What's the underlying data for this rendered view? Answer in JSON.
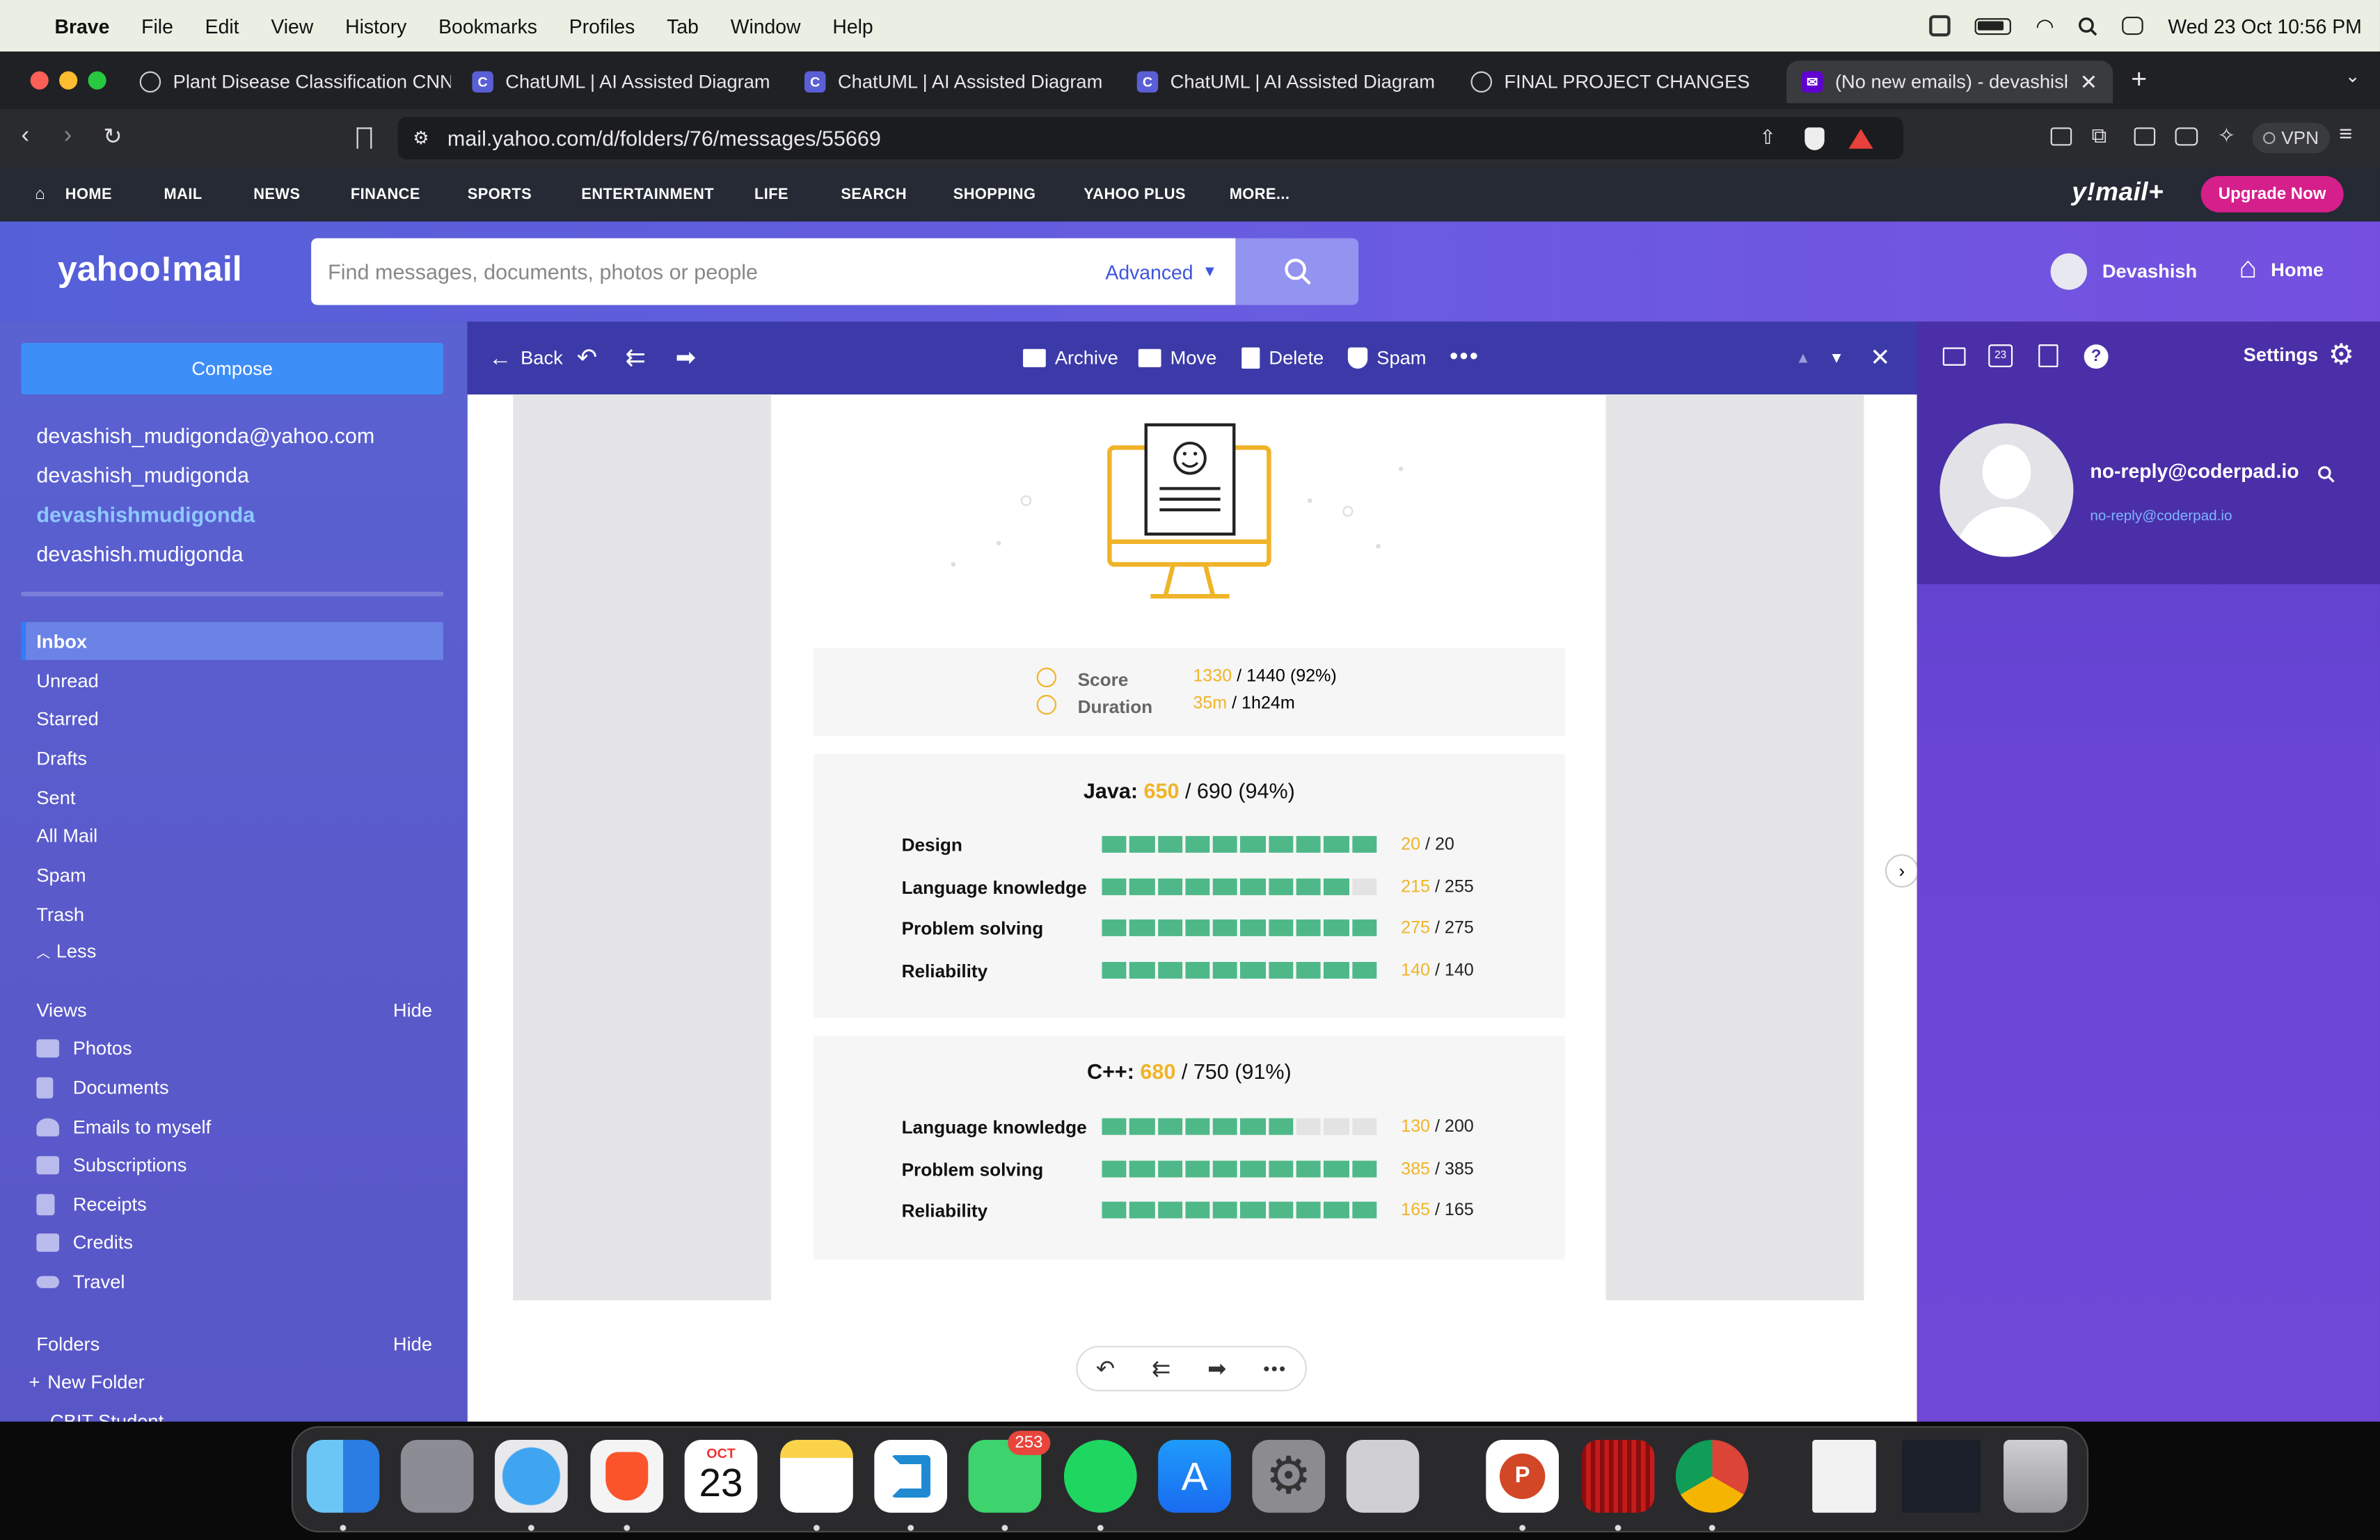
{
  "menubar": {
    "app": "Brave",
    "items": [
      "File",
      "Edit",
      "View",
      "History",
      "Bookmarks",
      "Profiles",
      "Tab",
      "Window",
      "Help"
    ],
    "datetime": "Wed 23 Oct  10:56 PM"
  },
  "tabs": [
    {
      "label": "Plant Disease Classification CNN",
      "icon": "openai-icon"
    },
    {
      "label": "ChatUML | AI Assisted Diagram G",
      "icon": "chatuml-icon"
    },
    {
      "label": "ChatUML | AI Assisted Diagram G",
      "icon": "chatuml-icon"
    },
    {
      "label": "ChatUML | AI Assisted Diagram G",
      "icon": "chatuml-icon"
    },
    {
      "label": "FINAL PROJECT CHANGES",
      "icon": "openai-icon"
    },
    {
      "label": "(No new emails) - devashishm",
      "icon": "yahoo-mail-icon"
    }
  ],
  "url": "mail.yahoo.com/d/folders/76/messages/55669",
  "vpn": "VPN",
  "ynav": {
    "items": [
      "HOME",
      "MAIL",
      "NEWS",
      "FINANCE",
      "SPORTS",
      "ENTERTAINMENT",
      "LIFE",
      "SEARCH",
      "SHOPPING",
      "YAHOO PLUS",
      "MORE..."
    ],
    "brand": "y!mail+",
    "upgrade": "Upgrade Now"
  },
  "header": {
    "logo": "yahoo!mail",
    "search_placeholder": "Find messages, documents, photos or people",
    "advanced": "Advanced",
    "user": "Devashish",
    "home": "Home"
  },
  "sidebar": {
    "compose": "Compose",
    "accounts": [
      "devashish_mudigonda@yahoo.com",
      "devashish_mudigonda",
      "devashishmudigonda",
      "devashish.mudigonda"
    ],
    "folders": [
      "Inbox",
      "Unread",
      "Starred",
      "Drafts",
      "Sent",
      "All Mail",
      "Spam",
      "Trash",
      "Less"
    ],
    "views_title": "Views",
    "views_hide": "Hide",
    "views": [
      "Photos",
      "Documents",
      "Emails to myself",
      "Subscriptions",
      "Receipts",
      "Credits",
      "Travel"
    ],
    "folders_title": "Folders",
    "folders_hide": "Hide",
    "new_folder": "New Folder",
    "cut_item": "CBIT Student"
  },
  "toolbar": {
    "back": "Back",
    "archive": "Archive",
    "move": "Move",
    "delete": "Delete",
    "spam": "Spam"
  },
  "email": {
    "summary": {
      "score_label": "Score",
      "score_value": "1330",
      "score_rest": " / 1440 (92%)",
      "duration_label": "Duration",
      "duration_value": "35m",
      "duration_rest": " / 1h24m"
    },
    "java": {
      "title": "Java:",
      "score": "650",
      "rest": " / 690 (94%)",
      "rows": [
        {
          "label": "Design",
          "score": "20",
          "max": " / 20",
          "level": 1.0
        },
        {
          "label": "Language knowledge",
          "score": "215",
          "max": " / 255",
          "level": 0.9
        },
        {
          "label": "Problem solving",
          "score": "275",
          "max": " / 275",
          "level": 1.0
        },
        {
          "label": "Reliability",
          "score": "140",
          "max": " / 140",
          "level": 1.0
        }
      ]
    },
    "cpp": {
      "title": "C++:",
      "score": "680",
      "rest": " / 750 (91%)",
      "rows": [
        {
          "label": "Language knowledge",
          "score": "130",
          "max": " / 200",
          "level": 0.7
        },
        {
          "label": "Problem solving",
          "score": "385",
          "max": " / 385",
          "level": 1.0
        },
        {
          "label": "Reliability",
          "score": "165",
          "max": " / 165",
          "level": 1.0
        }
      ]
    }
  },
  "rpane": {
    "settings": "Settings",
    "sender": "no-reply@coderpad.io",
    "sender_email": "no-reply@coderpad.io"
  },
  "dock": {
    "calendar_month": "OCT",
    "calendar_day": "23",
    "whatsapp_badge": "253"
  },
  "colors": {
    "accent": "#5b5fd6",
    "bar": "#4fb889",
    "gold": "#f0b428",
    "compose": "#3e8ef7"
  }
}
